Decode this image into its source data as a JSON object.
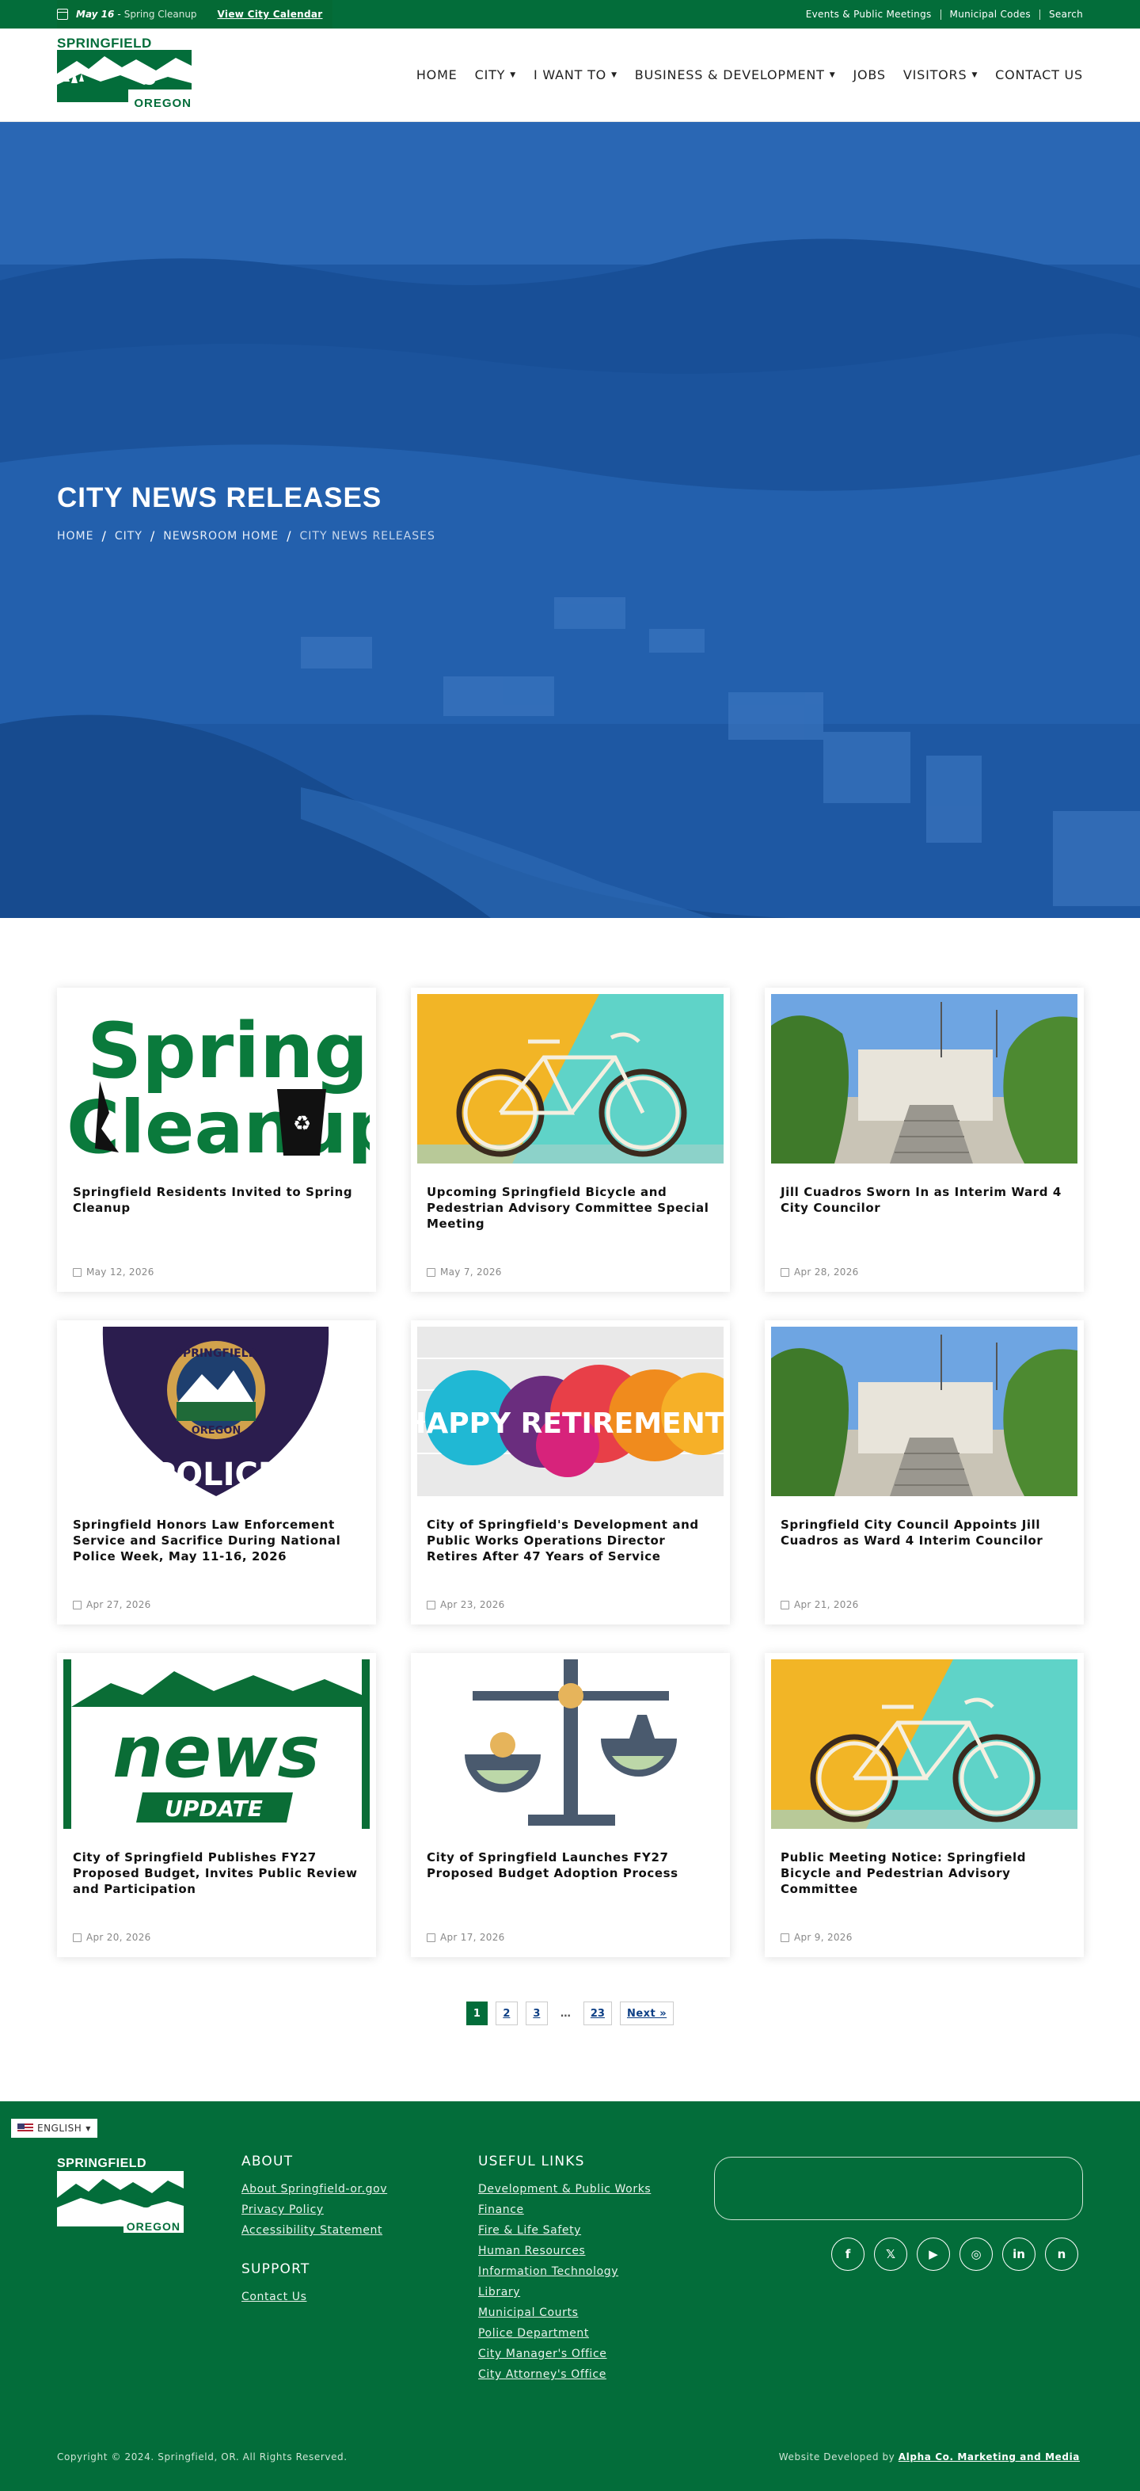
{
  "topbar": {
    "event_date": "May 16",
    "event_sep": " - ",
    "event_name": "Spring Cleanup",
    "calendar_link": "View City Calendar",
    "links": [
      "Events & Public Meetings",
      "Municipal Codes",
      "Search"
    ]
  },
  "brand": {
    "line1": "SPRINGFIELD",
    "line2": "OREGON"
  },
  "nav": [
    {
      "label": "HOME",
      "dropdown": false
    },
    {
      "label": "CITY",
      "dropdown": true
    },
    {
      "label": "I WANT TO",
      "dropdown": true
    },
    {
      "label": "BUSINESS & DEVELOPMENT",
      "dropdown": true
    },
    {
      "label": "JOBS",
      "dropdown": false
    },
    {
      "label": "VISITORS",
      "dropdown": true
    },
    {
      "label": "CONTACT US",
      "dropdown": false
    }
  ],
  "hero": {
    "title": "CITY NEWS RELEASES",
    "breadcrumb": [
      "HOME",
      "CITY",
      "NEWSROOM HOME",
      "CITY NEWS RELEASES"
    ]
  },
  "cards": [
    {
      "title": "Springfield Residents Invited to Spring Cleanup",
      "date": "May 12, 2026",
      "image": "spring-cleanup",
      "image_text": [
        "Spring",
        "Cleanup"
      ]
    },
    {
      "title": "Upcoming Springfield Bicycle and Pedestrian Advisory Committee Special Meeting",
      "date": "May 7, 2026",
      "image": "bicycle",
      "image_text": []
    },
    {
      "title": "Jill Cuadros Sworn In as Interim Ward 4 City Councilor",
      "date": "Apr 28, 2026",
      "image": "city-hall",
      "image_text": []
    },
    {
      "title": "Springfield Honors Law Enforcement Service and Sacrifice During National Police Week, May 11-16, 2026",
      "date": "Apr 27, 2026",
      "image": "police-badge",
      "image_text": [
        "SPRINGFIELD",
        "OREGON",
        "POLICE"
      ]
    },
    {
      "title": "City of Springfield's Development and Public Works Operations Director Retires After 47 Years of Service",
      "date": "Apr 23, 2026",
      "image": "retirement",
      "image_text": [
        "HAPPY RETIREMENT!"
      ]
    },
    {
      "title": "Springfield City Council Appoints Jill Cuadros as Ward 4 Interim Councilor",
      "date": "Apr 21, 2026",
      "image": "city-hall",
      "image_text": []
    },
    {
      "title": "City of Springfield Publishes FY27 Proposed Budget, Invites Public Review and Participation",
      "date": "Apr 20, 2026",
      "image": "news-update",
      "image_text": [
        "news",
        "UPDATE"
      ]
    },
    {
      "title": "City of Springfield Launches FY27 Proposed Budget Adoption Process",
      "date": "Apr 17, 2026",
      "image": "scales",
      "image_text": []
    },
    {
      "title": "Public Meeting Notice: Springfield Bicycle and Pedestrian Advisory Committee",
      "date": "Apr 9, 2026",
      "image": "bicycle",
      "image_text": []
    }
  ],
  "pagination": {
    "pages": [
      "1",
      "2",
      "3"
    ],
    "current": "1",
    "ellipsis": "…",
    "last": "23",
    "next": "Next »"
  },
  "footer": {
    "language": "ENGLISH",
    "about_heading": "ABOUT",
    "about_links": [
      "About Springfield-or.gov",
      "Privacy Policy",
      "Accessibility Statement"
    ],
    "support_heading": "SUPPORT",
    "support_links": [
      "Contact Us"
    ],
    "useful_heading": "USEFUL LINKS",
    "useful_links": [
      "Development & Public Works",
      "Finance",
      "Fire & Life Safety",
      "Human Resources",
      "Information Technology",
      "Library",
      "Municipal Courts",
      "Police Department",
      "City Manager's Office",
      "City Attorney's Office"
    ],
    "social": [
      "facebook-icon",
      "x-icon",
      "youtube-icon",
      "instagram-icon",
      "linkedin-icon",
      "nextdoor-icon"
    ],
    "copyright": "Copyright © 2024. Springfield, OR. All Rights Reserved.",
    "credit_prefix": "Website Developed by ",
    "credit_name": "Alpha Co. Marketing and Media"
  },
  "colors": {
    "brand_green": "#036d3a",
    "hero_blue": "#1f5aa6",
    "link_blue": "#0d3f85"
  }
}
